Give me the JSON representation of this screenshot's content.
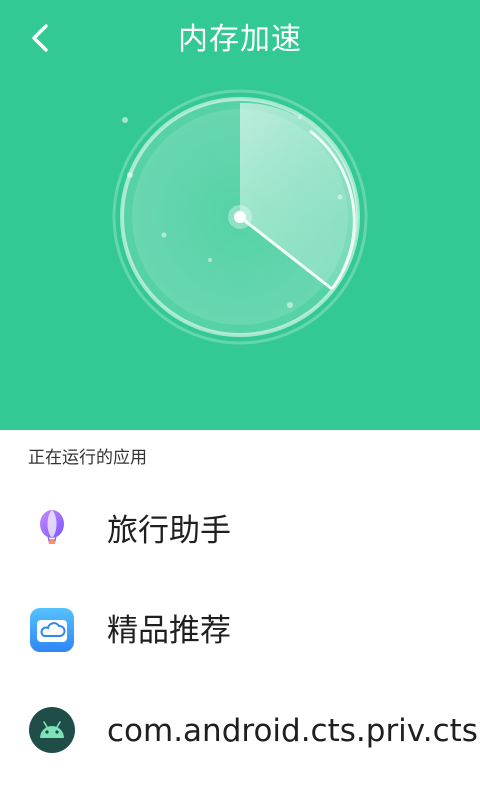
{
  "header": {
    "title": "内存加速",
    "back_icon": "back-arrow-icon",
    "background_color": "#33c995"
  },
  "section": {
    "title": "正在运行的应用"
  },
  "apps": [
    {
      "label": "旅行助手",
      "icon": "balloon-icon"
    },
    {
      "label": "精品推荐",
      "icon": "cloud-app-icon"
    },
    {
      "label": "com.android.cts.priv.cts",
      "icon": "android-icon"
    }
  ]
}
